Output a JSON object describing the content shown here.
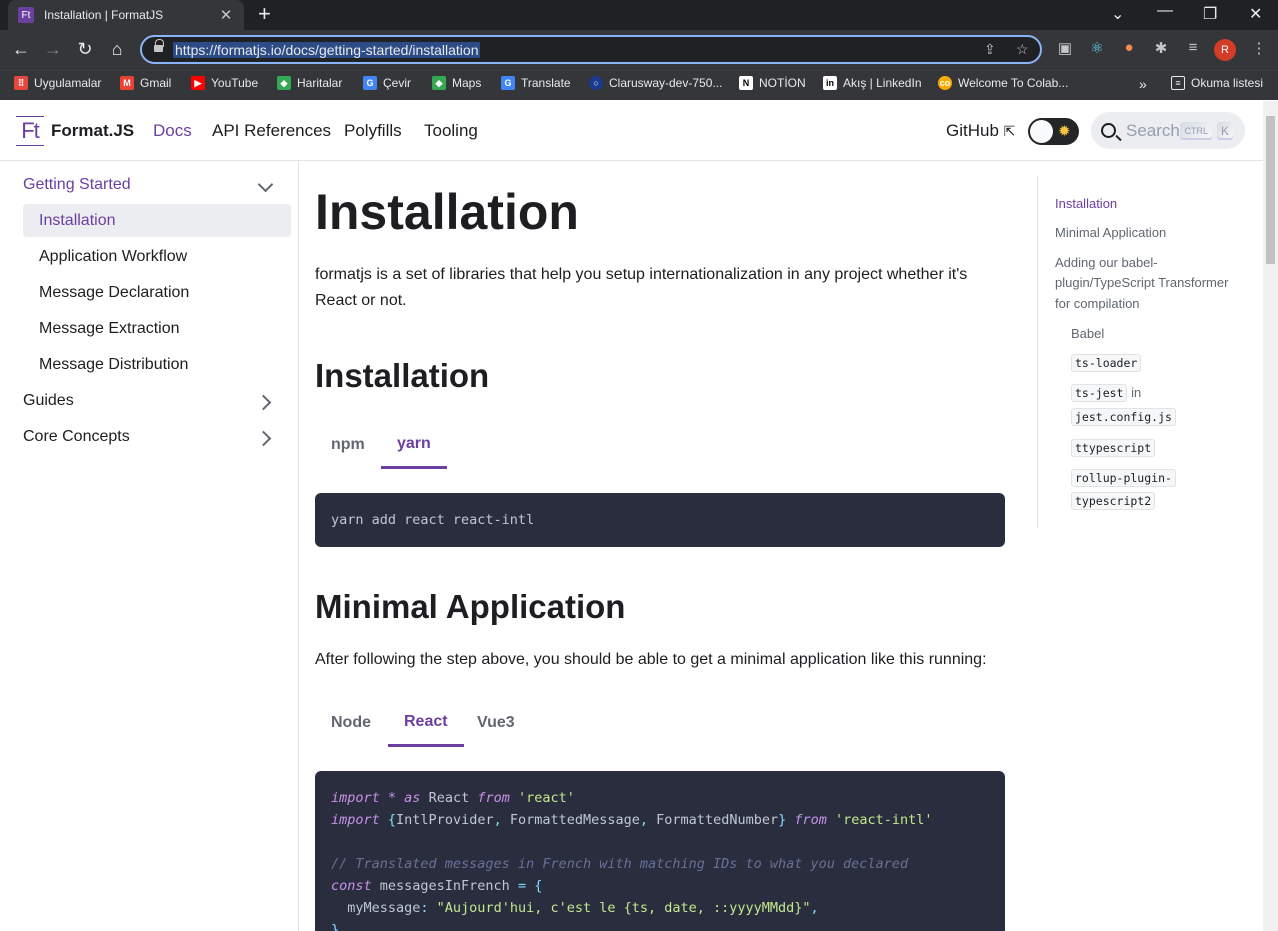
{
  "browser": {
    "tab_title": "Installation | FormatJS",
    "tab_favicon": "Ft",
    "url": "https://formatjs.io/docs/getting-started/installation",
    "avatar_letter": "R",
    "bookmarks": [
      {
        "label": "Uygulamalar",
        "icon": "apps-grid-icon",
        "color": "#e8453c"
      },
      {
        "label": "Gmail",
        "icon": "gmail-icon",
        "color": "#ea4335"
      },
      {
        "label": "YouTube",
        "icon": "youtube-icon",
        "color": "#ff0000"
      },
      {
        "label": "Haritalar",
        "icon": "maps-icon",
        "color": "#34a853"
      },
      {
        "label": "Çevir",
        "icon": "translate-icon",
        "color": "#4285f4"
      },
      {
        "label": "Maps",
        "icon": "maps-icon",
        "color": "#34a853"
      },
      {
        "label": "Translate",
        "icon": "translate-icon",
        "color": "#4285f4"
      },
      {
        "label": "Clarusway-dev-750...",
        "icon": "clarusway-icon",
        "color": "#1a3a8f"
      },
      {
        "label": "NOTİON",
        "icon": "notion-icon",
        "color": "#ffffff"
      },
      {
        "label": "Akış | LinkedIn",
        "icon": "linkedin-icon",
        "color": "#ffffff"
      },
      {
        "label": "Welcome To Colab...",
        "icon": "colab-icon",
        "color": "#f9ab00"
      }
    ],
    "reading_list": "Okuma listesi",
    "more": "»"
  },
  "site": {
    "logo": "Ft",
    "brand": "Format.JS",
    "nav": [
      "Docs",
      "API References",
      "Polyfills",
      "Tooling"
    ],
    "github": "GitHub",
    "search_placeholder": "Search",
    "kbd_ctrl": "CTRL",
    "kbd_k": "K"
  },
  "sidebar": {
    "getting_started": "Getting Started",
    "items": [
      "Installation",
      "Application Workflow",
      "Message Declaration",
      "Message Extraction",
      "Message Distribution"
    ],
    "guides": "Guides",
    "core_concepts": "Core Concepts"
  },
  "main": {
    "title": "Installation",
    "intro_1": "formatjs is a set of libraries that help you setup internationalization in any project whether it's",
    "intro_2": "React or not.",
    "install_heading": "Installation",
    "install_tabs": [
      "npm",
      "yarn"
    ],
    "install_cmd": "yarn add react react-intl",
    "minimal_heading": "Minimal Application",
    "minimal_text": "After following the step above, you should be able to get a minimal application like this running:",
    "app_tabs": [
      "Node",
      "React",
      "Vue3"
    ],
    "code": {
      "l1_kw": "import",
      "l1_mid": " * ",
      "l1_as": "as",
      "l1_name": " React ",
      "l1_from": "from",
      "l1_str": " 'react'",
      "l2_kw": "import",
      "l2_open": " {",
      "l2_a": "IntlProvider",
      "l2_c1": ", ",
      "l2_b": "FormattedMessage",
      "l2_c2": ", ",
      "l2_c": "FormattedNumber",
      "l2_close": "} ",
      "l2_from": "from",
      "l2_str": " 'react-intl'",
      "l3": "// Translated messages in French with matching IDs to what you declared",
      "l4_kw": "const",
      "l4_name": " messagesInFrench ",
      "l4_eq": "= {",
      "l5_key": "  myMessage",
      "l5_colon": ": ",
      "l5_str": "\"Aujourd'hui, c'est le {ts, date, ::yyyyMMdd}\"",
      "l5_comma": ",",
      "l6": "}"
    }
  },
  "toc": {
    "items": [
      "Installation",
      "Minimal Application",
      "Adding our babel-",
      "plugin/TypeScript Transformer",
      "for compilation",
      "Babel",
      "ts-loader",
      "ts-jest",
      "in",
      "jest.config.js",
      "ttypescript",
      "rollup-plugin-",
      "typescript2"
    ]
  }
}
